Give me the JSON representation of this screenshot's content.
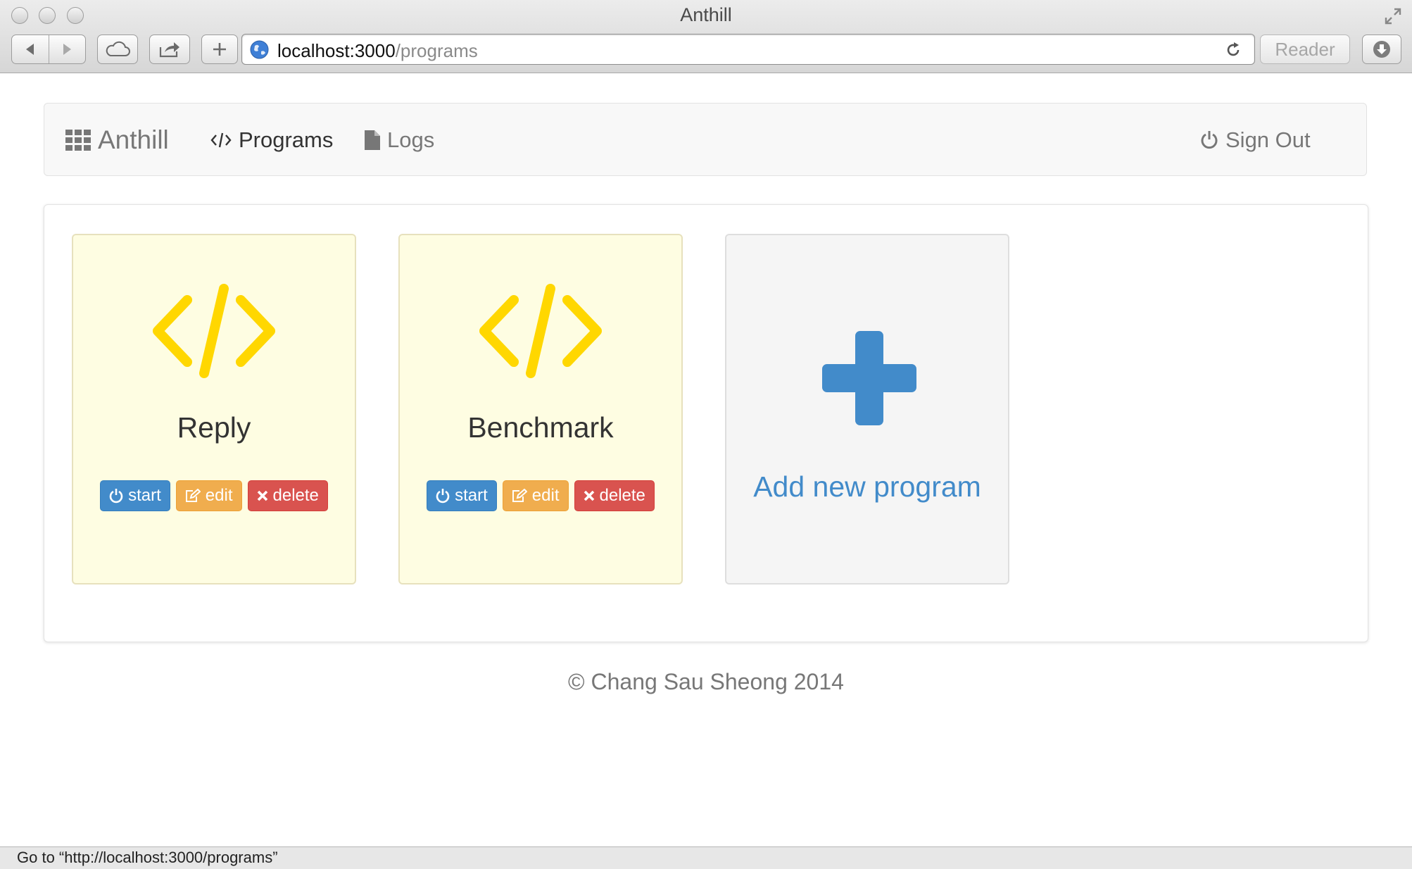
{
  "window": {
    "title": "Anthill"
  },
  "toolbar": {
    "url_host": "localhost:3000",
    "url_path": "/programs",
    "reader_label": "Reader"
  },
  "navbar": {
    "brand": "Anthill",
    "programs": "Programs",
    "logs": "Logs",
    "sign_out": "Sign Out"
  },
  "programs": [
    {
      "name": "Reply",
      "start": "start",
      "edit": "edit",
      "delete": "delete"
    },
    {
      "name": "Benchmark",
      "start": "start",
      "edit": "edit",
      "delete": "delete"
    }
  ],
  "add_card": {
    "label": "Add new program"
  },
  "footer": {
    "text": "© Chang Sau Sheong 2014"
  },
  "status_bar": {
    "text": "Go to “http://localhost:3000/programs”"
  },
  "colors": {
    "primary": "#428bca",
    "warning": "#f0ad4e",
    "danger": "#d9534f",
    "code_icon": "#ffd700",
    "card_bg": "#fefde2"
  }
}
